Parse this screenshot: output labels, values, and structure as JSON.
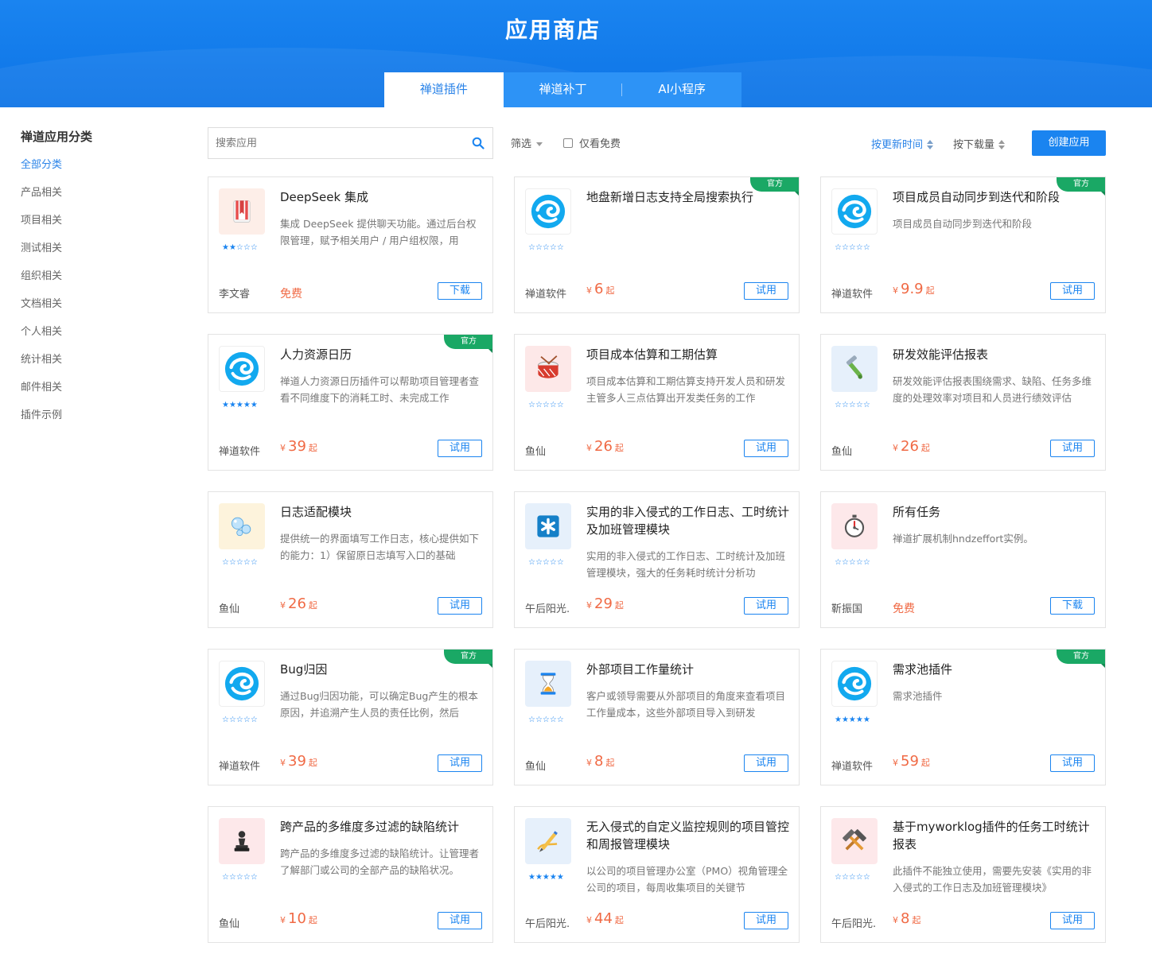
{
  "header": {
    "title": "应用商店",
    "tabs": [
      {
        "label": "禅道插件",
        "active": true
      },
      {
        "label": "禅道补丁",
        "active": false
      },
      {
        "label": "AI小程序",
        "active": false
      }
    ]
  },
  "sidebar": {
    "title": "禅道应用分类",
    "items": [
      {
        "label": "全部分类",
        "active": true
      },
      {
        "label": "产品相关",
        "active": false
      },
      {
        "label": "项目相关",
        "active": false
      },
      {
        "label": "测试相关",
        "active": false
      },
      {
        "label": "组织相关",
        "active": false
      },
      {
        "label": "文档相关",
        "active": false
      },
      {
        "label": "个人相关",
        "active": false
      },
      {
        "label": "统计相关",
        "active": false
      },
      {
        "label": "邮件相关",
        "active": false
      },
      {
        "label": "插件示例",
        "active": false
      }
    ]
  },
  "toolbar": {
    "search_placeholder": "搜索应用",
    "filter_label": "筛选",
    "free_only_label": "仅看免费",
    "sort_by_update": "按更新时间",
    "sort_by_downloads": "按下载量",
    "create_label": "创建应用"
  },
  "colors": {
    "primary": "#1a84f0",
    "price": "#f06a45",
    "official_badge": "#1aa865"
  },
  "apps": [
    {
      "name": "DeepSeek 集成",
      "desc": "集成 DeepSeek 提供聊天功能。通过后台权限管理，赋予相关用户 / 用户组权限，用",
      "author": "李文睿",
      "price": "免费",
      "free": true,
      "rating": 2,
      "button": "下载",
      "official": false,
      "icon": "book-icon"
    },
    {
      "name": "地盘新增日志支持全局搜索执行",
      "desc": "",
      "author": "禅道软件",
      "price": "6",
      "free": false,
      "rating": 0,
      "button": "试用",
      "official": true,
      "official_label": "官方",
      "icon": "zentao-logo-icon"
    },
    {
      "name": "项目成员自动同步到迭代和阶段",
      "desc": "项目成员自动同步到迭代和阶段",
      "author": "禅道软件",
      "price": "9.9",
      "free": false,
      "rating": 0,
      "button": "试用",
      "official": true,
      "official_label": "官方",
      "icon": "zentao-logo-icon"
    },
    {
      "name": "人力资源日历",
      "desc": "禅道人力资源日历插件可以帮助项目管理者查看不同维度下的消耗工时、未完成工作",
      "author": "禅道软件",
      "price": "39",
      "free": false,
      "rating": 5,
      "button": "试用",
      "official": true,
      "official_label": "官方",
      "icon": "zentao-logo-icon"
    },
    {
      "name": "项目成本估算和工期估算",
      "desc": "项目成本估算和工期估算支持开发人员和研发主管多人三点估算出开发类任务的工作",
      "author": "鱼仙",
      "price": "26",
      "free": false,
      "rating": 0,
      "button": "试用",
      "official": false,
      "icon": "drum-icon"
    },
    {
      "name": "研发效能评估报表",
      "desc": "研发效能评估报表围绕需求、缺陷、任务多维度的处理效率对项目和人员进行绩效评估",
      "author": "鱼仙",
      "price": "26",
      "free": false,
      "rating": 0,
      "button": "试用",
      "official": false,
      "icon": "razor-icon"
    },
    {
      "name": "日志适配模块",
      "desc": "提供统一的界面填写工作日志，核心提供如下的能力：1）保留原日志填写入口的基础",
      "author": "鱼仙",
      "price": "26",
      "free": false,
      "rating": 0,
      "button": "试用",
      "official": false,
      "icon": "bubbles-icon"
    },
    {
      "name": "实用的非入侵式的工作日志、工时统计及加班管理模块",
      "desc": "实用的非入侵式的工作日志、工时统计及加班管理模块，强大的任务耗时统计分析功",
      "author": "午后阳光.",
      "price": "29",
      "free": false,
      "rating": 0,
      "button": "试用",
      "official": false,
      "icon": "asterisk-icon"
    },
    {
      "name": "所有任务",
      "desc": "禅道扩展机制hndzeffort实例。",
      "author": "靳振国",
      "price": "免费",
      "free": true,
      "rating": 0,
      "button": "下载",
      "official": false,
      "icon": "stopwatch-icon"
    },
    {
      "name": "Bug归因",
      "desc": "通过Bug归因功能，可以确定Bug产生的根本原因，并追溯产生人员的责任比例，然后",
      "author": "禅道软件",
      "price": "39",
      "free": false,
      "rating": 0,
      "button": "试用",
      "official": true,
      "official_label": "官方",
      "icon": "zentao-logo-icon"
    },
    {
      "name": "外部项目工作量统计",
      "desc": "客户或领导需要从外部项目的角度来查看项目工作量成本，这些外部项目导入到研发",
      "author": "鱼仙",
      "price": "8",
      "free": false,
      "rating": 0,
      "button": "试用",
      "official": false,
      "icon": "hourglass-icon"
    },
    {
      "name": "需求池插件",
      "desc": "需求池插件",
      "author": "禅道软件",
      "price": "59",
      "free": false,
      "rating": 5,
      "button": "试用",
      "official": true,
      "official_label": "官方",
      "icon": "zentao-logo-icon"
    },
    {
      "name": "跨产品的多维度多过滤的缺陷统计",
      "desc": "跨产品的多维度多过滤的缺陷统计。让管理者了解部门或公司的全部产品的缺陷状况。",
      "author": "鱼仙",
      "price": "10",
      "free": false,
      "rating": 0,
      "button": "试用",
      "official": false,
      "icon": "chess-pawn-icon"
    },
    {
      "name": "无入侵式的自定义监控规则的项目管控和周报管理模块",
      "desc": "以公司的项目管理办公室（PMO）视角管理全公司的项目，每周收集项目的关键节",
      "author": "午后阳光.",
      "price": "44",
      "free": false,
      "rating": 5,
      "button": "试用",
      "official": false,
      "icon": "pen-icon"
    },
    {
      "name": "基于myworklog插件的任务工时统计报表",
      "desc": "此插件不能独立使用，需要先安装《实用的非入侵式的工作日志及加班管理模块》",
      "author": "午后阳光.",
      "price": "8",
      "free": false,
      "rating": 0,
      "button": "试用",
      "official": false,
      "icon": "hammers-icon"
    }
  ],
  "price_prefix": "¥",
  "price_suffix": "起"
}
